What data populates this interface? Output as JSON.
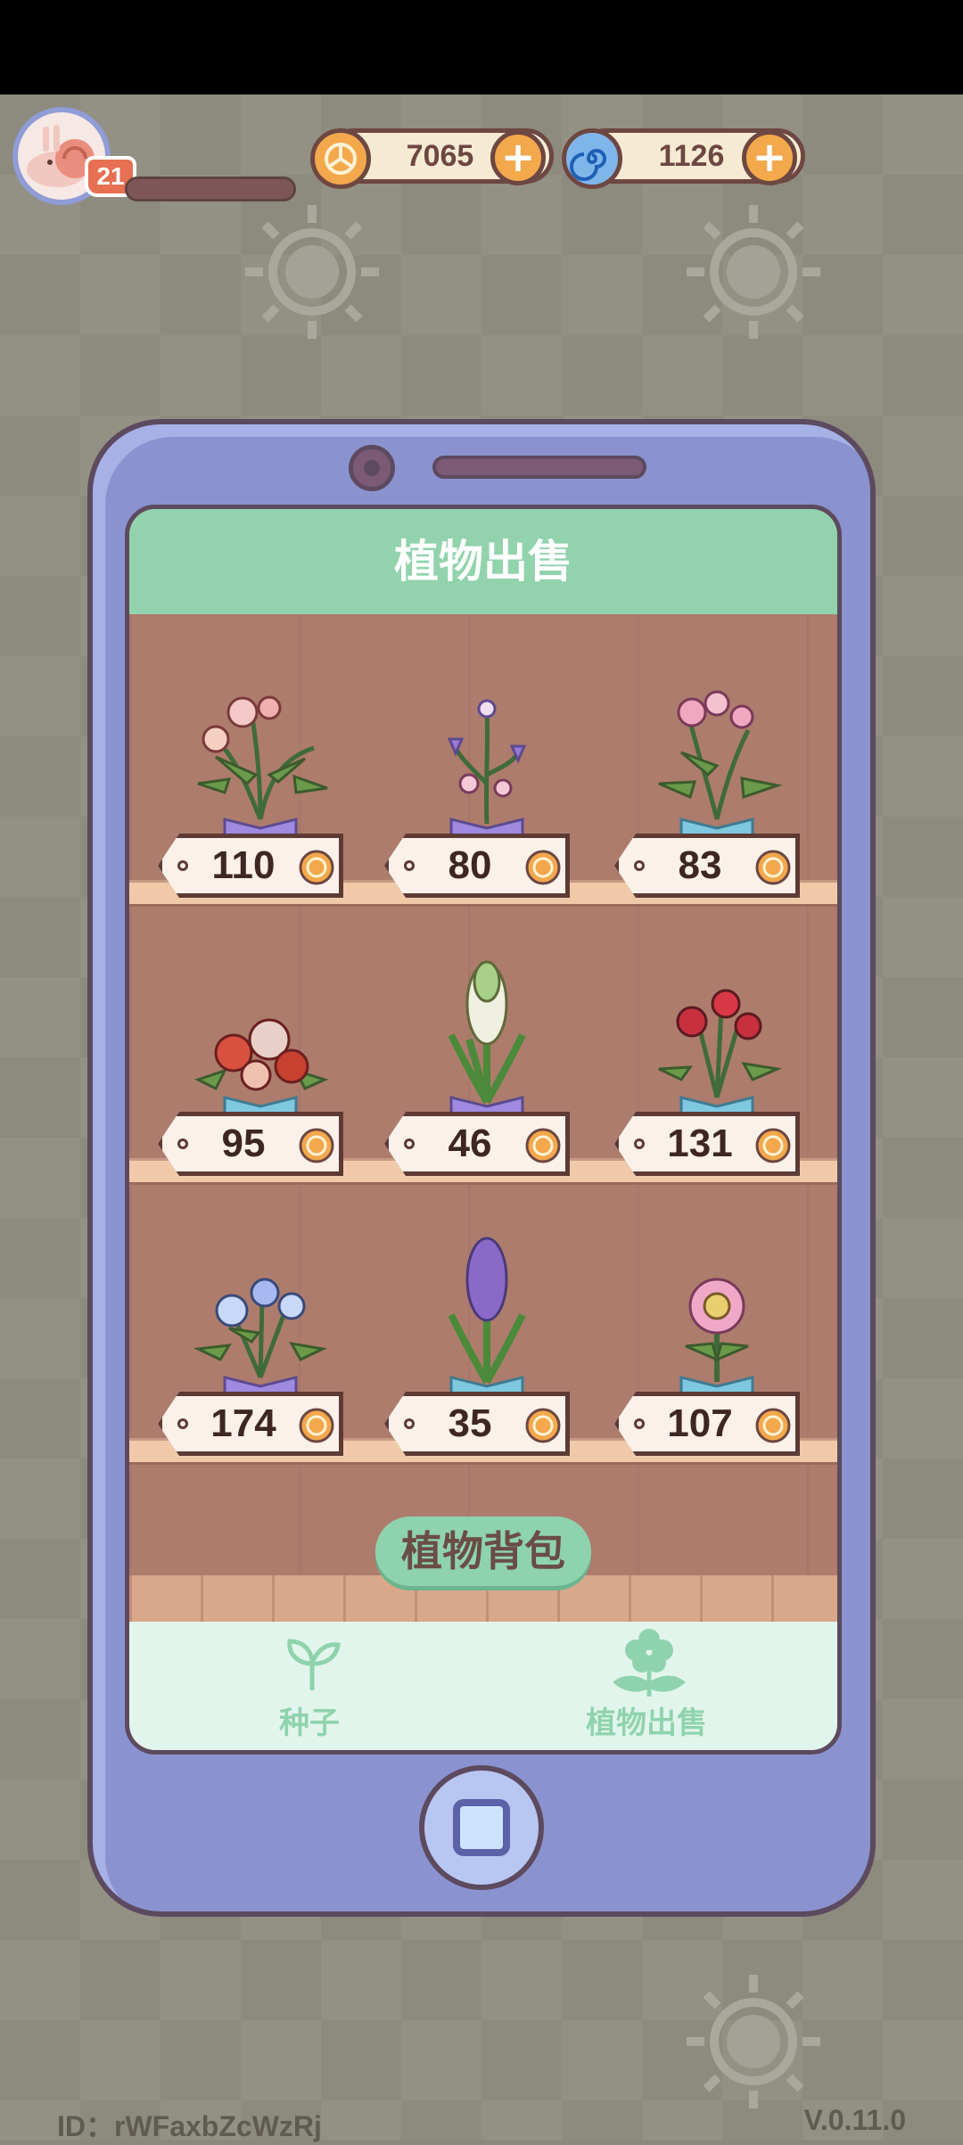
{
  "hud": {
    "level": "21",
    "coins": "7065",
    "gems": "1126"
  },
  "panel": {
    "title": "植物出售",
    "bag_button": "植物背包"
  },
  "plants": [
    {
      "price": "110"
    },
    {
      "price": "80"
    },
    {
      "price": "83"
    },
    {
      "price": "95"
    },
    {
      "price": "46"
    },
    {
      "price": "131"
    },
    {
      "price": "174"
    },
    {
      "price": "35"
    },
    {
      "price": "107"
    }
  ],
  "tabs": [
    {
      "label": "种子",
      "icon": "sprout-icon"
    },
    {
      "label": "植物出售",
      "icon": "flower-icon"
    }
  ],
  "footer": {
    "id": "ID：rWFaxbZcWzRj",
    "version": "V.0.11.0"
  },
  "colors": {
    "header_green": "#92d3ad",
    "phone_purple": "#8a93cf",
    "coin_orange": "#f3a84c",
    "wood": "#ad7c6c"
  }
}
